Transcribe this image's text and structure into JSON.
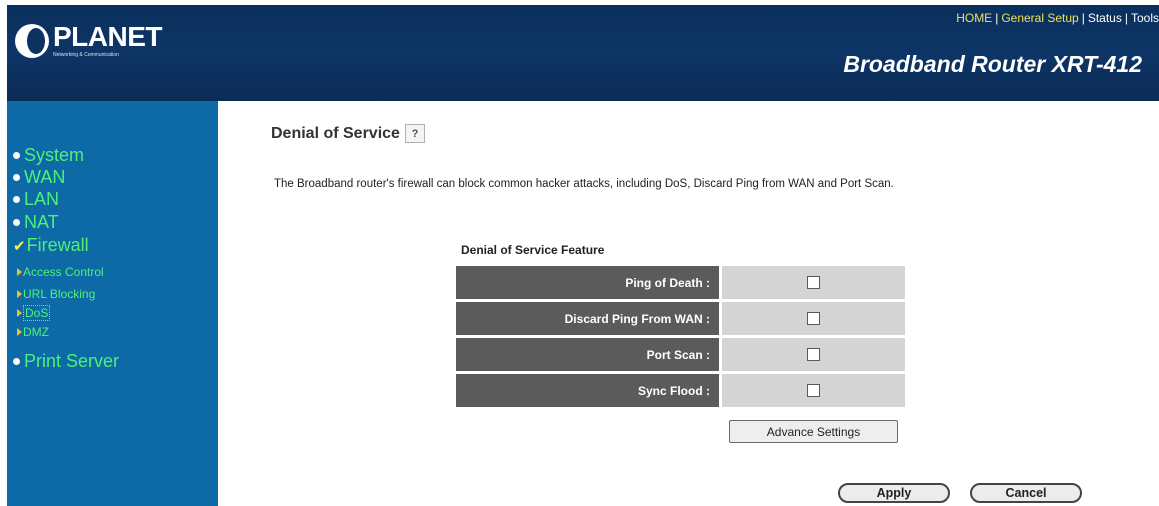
{
  "header": {
    "logo_text": "PLANET",
    "logo_tagline": "Networking & Communication",
    "top_links": [
      "HOME",
      "General Setup",
      "Status",
      "Tools"
    ],
    "product_name": "Broadband Router XRT-412"
  },
  "sidebar": {
    "items": [
      {
        "label": "System"
      },
      {
        "label": "WAN"
      },
      {
        "label": "LAN"
      },
      {
        "label": "NAT"
      },
      {
        "label": "Firewall"
      },
      {
        "label": "Print Server"
      }
    ],
    "firewall_sub": [
      {
        "label": "Access Control"
      },
      {
        "label": "URL Blocking"
      },
      {
        "label": "DoS"
      },
      {
        "label": "DMZ"
      }
    ]
  },
  "main": {
    "title": "Denial of Service",
    "help_glyph": "?",
    "description": "The Broadband router's firewall can block common hacker attacks, including DoS, Discard Ping from WAN and Port Scan.",
    "feature_title": "Denial of Service Feature",
    "features": [
      {
        "label": "Ping of Death :",
        "checked": false
      },
      {
        "label": "Discard Ping From WAN :",
        "checked": false
      },
      {
        "label": "Port Scan :",
        "checked": false
      },
      {
        "label": "Sync Flood :",
        "checked": false
      }
    ],
    "advance_button": "Advance Settings",
    "apply_button": "Apply",
    "cancel_button": "Cancel"
  }
}
